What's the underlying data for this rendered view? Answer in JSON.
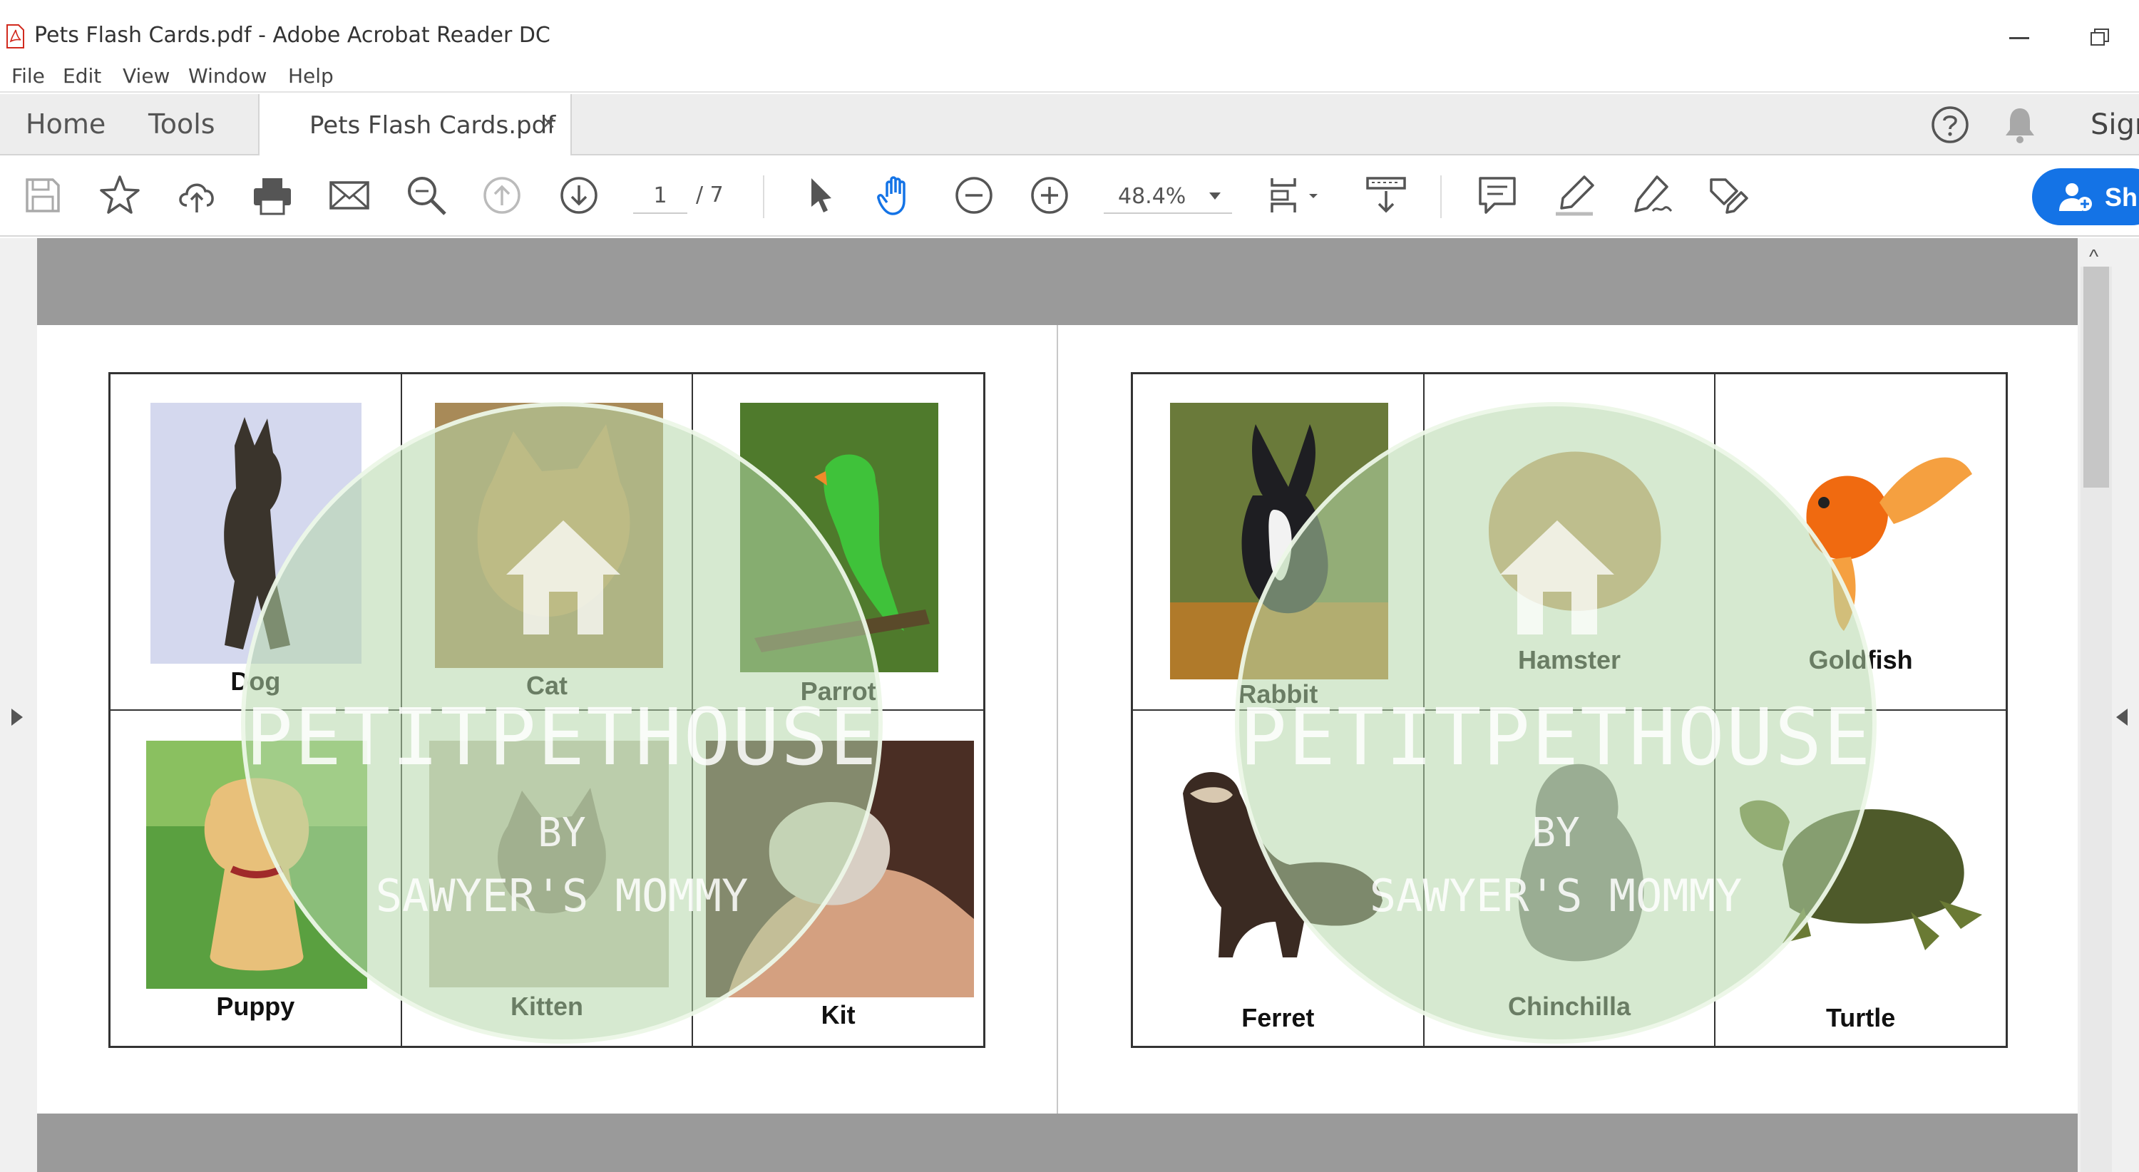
{
  "window": {
    "title": "Pets Flash Cards.pdf - Adobe Acrobat Reader DC"
  },
  "menu": [
    "File",
    "Edit",
    "View",
    "Window",
    "Help"
  ],
  "tabs": {
    "home": "Home",
    "tools": "Tools",
    "document": "Pets Flash Cards.pdf",
    "close": "×",
    "sign": "Sign"
  },
  "toolbar": {
    "current_page": "1",
    "total_pages": "/ 7",
    "zoom": "48.4%",
    "share_label": "Sh"
  },
  "icons": [
    "save-icon",
    "star-icon",
    "cloud-upload-icon",
    "print-icon",
    "mail-icon",
    "find-icon",
    "page-up-icon",
    "page-down-icon",
    "select-arrow-icon",
    "hand-icon",
    "zoom-out-icon",
    "zoom-in-icon",
    "fit-page-icon",
    "scroll-mode-icon",
    "comment-icon",
    "highlight-icon",
    "sign-icon",
    "edit-stamp-icon"
  ],
  "pages": {
    "left": {
      "cards": [
        {
          "label": "Dog",
          "color": "#8a8fb6"
        },
        {
          "label": "Cat",
          "color": "#b58a4c"
        },
        {
          "label": "Parrot",
          "color": "#4a8a2b"
        },
        {
          "label": "Puppy",
          "color": "#d6a85c"
        },
        {
          "label": "Kitten",
          "color": "#b4ab96"
        },
        {
          "label": "Kit",
          "color": "#a87866"
        }
      ],
      "watermark": {
        "line1": "PETITPETHOUSE",
        "line2": "BY",
        "line3": "SAWYER'S MOMMY"
      }
    },
    "right": {
      "cards": [
        {
          "label": "Rabbit",
          "color": "#6b6a3a"
        },
        {
          "label": "Hamster",
          "color": "#c7a070"
        },
        {
          "label": "Goldfish",
          "color": "#f07a1c"
        },
        {
          "label": "Ferret",
          "color": "#3e2c22"
        },
        {
          "label": "Chinchilla",
          "color": "#7a7a78"
        },
        {
          "label": "Turtle",
          "color": "#5c6a3a"
        }
      ],
      "watermark": {
        "line1": "PETITPETHOUSE",
        "line2": "BY",
        "line3": "SAWYER'S MOMMY"
      }
    }
  },
  "colors": {
    "accent": "#1473e6",
    "watermark": "#b4d7aa",
    "page_background": "#9a9a9a"
  }
}
